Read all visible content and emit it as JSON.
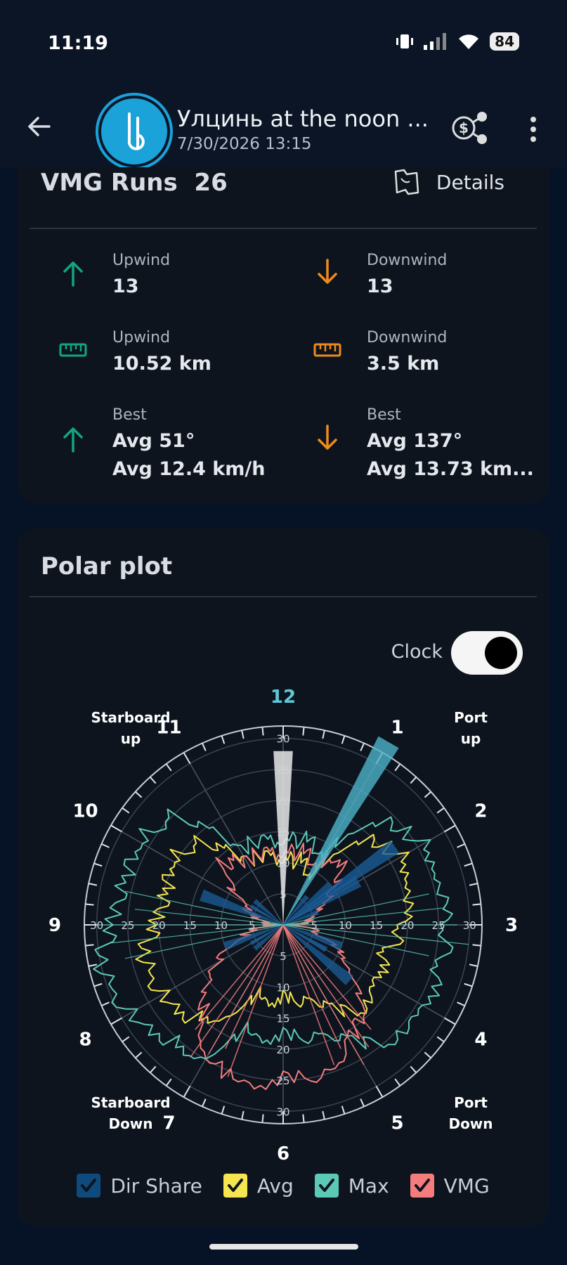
{
  "status_bar": {
    "time": "11:19",
    "battery": "84"
  },
  "header": {
    "title": "Улцинь at the noon ...",
    "subtitle": "7/30/2026 13:15"
  },
  "vmg": {
    "title": "VMG Runs",
    "count": "26",
    "details_label": "Details",
    "stats": [
      {
        "label": "Upwind",
        "value": "13",
        "icon": "arrow-up-icon",
        "color": "#13a57f"
      },
      {
        "label": "Downwind",
        "value": "13",
        "icon": "arrow-down-icon",
        "color": "#f08a1c"
      },
      {
        "label": "Upwind",
        "value": "10.52 km",
        "icon": "ruler-icon",
        "color": "#13a57f"
      },
      {
        "label": "Downwind",
        "value": "3.5 km",
        "icon": "ruler-icon",
        "color": "#f08a1c"
      },
      {
        "label": "Best",
        "value": "Avg 51°",
        "value2": "Avg 12.4 km/h",
        "icon": "arrow-up-icon",
        "color": "#13a57f"
      },
      {
        "label": "Best",
        "value": "Avg 137°",
        "value2": "Avg 13.73 km...",
        "icon": "arrow-down-icon",
        "color": "#f08a1c"
      }
    ]
  },
  "polar": {
    "title": "Polar plot",
    "clock_label": "Clock",
    "clock_on": true,
    "sectors": {
      "starboard_up": [
        "Starboard",
        "up"
      ],
      "port_up": [
        "Port",
        "up"
      ],
      "starboard_down": [
        "Starboard",
        "Down"
      ],
      "port_down": [
        "Port",
        "Down"
      ]
    },
    "legend": [
      {
        "label": "Dir Share",
        "color": "#0f4a7c"
      },
      {
        "label": "Avg",
        "color": "#f5e650"
      },
      {
        "label": "Max",
        "color": "#5cc9b7"
      },
      {
        "label": "VMG",
        "color": "#f57c7c"
      }
    ]
  },
  "chart_data": {
    "type": "polar",
    "angular_labels": [
      "12",
      "1",
      "2",
      "3",
      "4",
      "5",
      "6",
      "7",
      "8",
      "9",
      "10",
      "11"
    ],
    "radial_ticks": [
      5,
      10,
      15,
      20,
      25,
      30
    ],
    "rmax": 32,
    "series": [
      {
        "name": "Dir Share",
        "color": "#1a5d99",
        "spikes": [
          [
            0,
            28
          ],
          [
            30,
            34
          ],
          [
            55,
            22
          ],
          [
            120,
            8
          ],
          [
            300,
            6
          ],
          [
            240,
            6
          ]
        ]
      },
      {
        "name": "Avg",
        "color": "#f5e650",
        "profile": [
          [
            30,
            10
          ],
          [
            45,
            20
          ],
          [
            60,
            22
          ],
          [
            75,
            20
          ],
          [
            90,
            19
          ],
          [
            105,
            17
          ],
          [
            120,
            18
          ],
          [
            135,
            19
          ],
          [
            150,
            16
          ],
          [
            160,
            12
          ],
          [
            200,
            12
          ],
          [
            210,
            16
          ],
          [
            225,
            21
          ],
          [
            240,
            22
          ],
          [
            255,
            23
          ],
          [
            270,
            21
          ],
          [
            285,
            19
          ],
          [
            300,
            21
          ],
          [
            315,
            19
          ],
          [
            330,
            12
          ]
        ]
      },
      {
        "name": "Max",
        "color": "#5cc9b7",
        "profile": [
          [
            30,
            14
          ],
          [
            45,
            24
          ],
          [
            60,
            26
          ],
          [
            75,
            25
          ],
          [
            90,
            26
          ],
          [
            105,
            26
          ],
          [
            120,
            27
          ],
          [
            135,
            26
          ],
          [
            150,
            22
          ],
          [
            160,
            18
          ],
          [
            200,
            18
          ],
          [
            210,
            24
          ],
          [
            225,
            26
          ],
          [
            240,
            28
          ],
          [
            255,
            30
          ],
          [
            270,
            28
          ],
          [
            285,
            26
          ],
          [
            300,
            27
          ],
          [
            315,
            25
          ],
          [
            330,
            14
          ]
        ]
      },
      {
        "name": "VMG",
        "color": "#f57c7c",
        "profile": [
          [
            30,
            12
          ],
          [
            45,
            14
          ],
          [
            60,
            8
          ],
          [
            75,
            4
          ],
          [
            90,
            2
          ],
          [
            105,
            6
          ],
          [
            120,
            12
          ],
          [
            135,
            18
          ],
          [
            150,
            22
          ],
          [
            160,
            24
          ],
          [
            200,
            26
          ],
          [
            210,
            24
          ],
          [
            225,
            18
          ],
          [
            240,
            12
          ],
          [
            255,
            6
          ],
          [
            270,
            2
          ],
          [
            285,
            4
          ],
          [
            300,
            8
          ],
          [
            315,
            14
          ],
          [
            330,
            12
          ]
        ]
      }
    ]
  }
}
